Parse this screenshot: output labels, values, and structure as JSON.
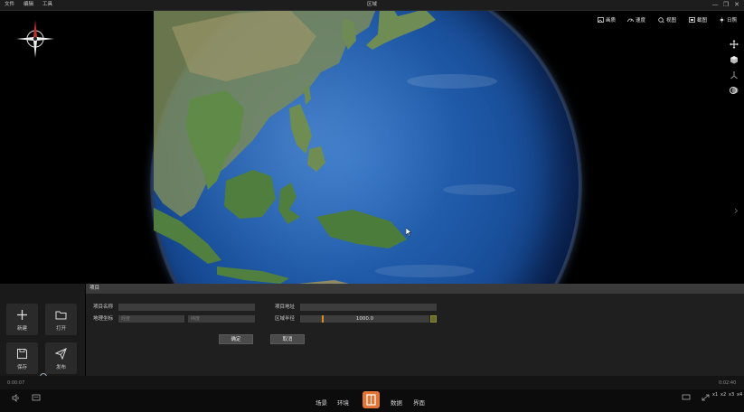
{
  "window": {
    "title": "区域",
    "menu": [
      "文件",
      "编辑",
      "工具"
    ],
    "controls": [
      "—",
      "❐",
      "✕"
    ]
  },
  "viewport_toolbar": [
    {
      "icon": "picture-icon",
      "label": "画质"
    },
    {
      "icon": "gauge-icon",
      "label": "速度"
    },
    {
      "icon": "view-icon",
      "label": "视图"
    },
    {
      "icon": "screenshot-icon",
      "label": "截图"
    },
    {
      "icon": "sun-icon",
      "label": "日照"
    }
  ],
  "right_tools": [
    "move-icon",
    "cube-icon",
    "axis-icon",
    "layers-icon"
  ],
  "left_panel": {
    "tiles": [
      {
        "icon": "plus-icon",
        "label": "新建"
      },
      {
        "icon": "folder-icon",
        "label": "打开"
      },
      {
        "icon": "save-icon",
        "label": "保存"
      },
      {
        "icon": "send-icon",
        "label": "发布"
      }
    ],
    "slider_value": 0.48
  },
  "form": {
    "title": "项目",
    "name_label": "项目名称",
    "name_value": "",
    "address_label": "项目地址",
    "address_value": "",
    "coord_label": "地理坐标",
    "lng_placeholder": "经度",
    "lat_placeholder": "纬度",
    "radius_label": "区域半径",
    "radius_value": "1000.0",
    "confirm": "确定",
    "cancel": "取消"
  },
  "timeline": {
    "current": "0:00:07",
    "total": "0:02:40"
  },
  "bottom_nav": {
    "items": [
      "场景",
      "环境",
      "数据",
      "界面"
    ],
    "active_icon": "book-icon"
  },
  "bottom_right": {
    "zoom_levels": [
      "x1",
      "x2",
      "x3",
      "x4"
    ]
  },
  "colors": {
    "accent": "#e07535",
    "slider": "#4a7bd1",
    "range_marker": "#e08a2a"
  }
}
